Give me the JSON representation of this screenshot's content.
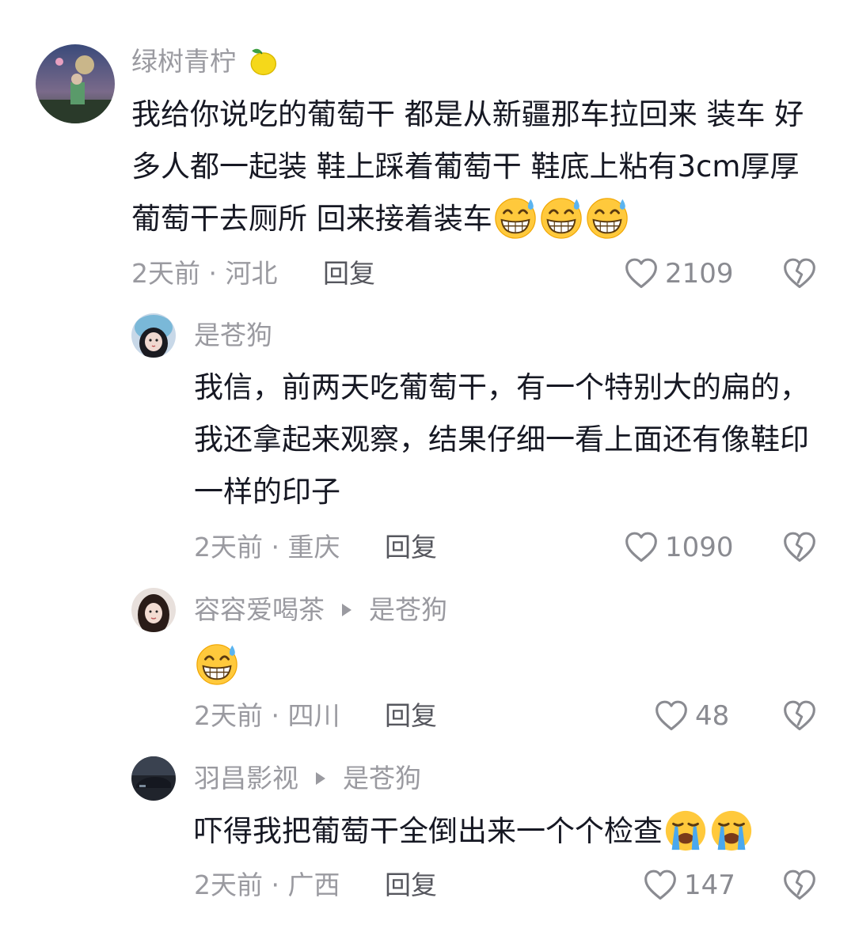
{
  "comments": [
    {
      "username": "绿树青柠",
      "username_icon": "lemon-icon",
      "text": "我给你说吃的葡萄干  都是从新疆那车拉回来  装车 好多人都一起装  鞋上踩着葡萄干  鞋底上粘有3cm厚厚葡萄干去厕所  回来接着装车",
      "emojis": [
        "grin-sweat-emoji",
        "grin-sweat-emoji",
        "grin-sweat-emoji"
      ],
      "meta": "2天前 · 河北",
      "reply_label": "回复",
      "likes": "2109"
    },
    {
      "username": "是苍狗",
      "text": "我信，前两天吃葡萄干，有一个特别大的扁的，我还拿起来观察，结果仔细一看上面还有像鞋印一样的印子",
      "meta": "2天前 · 重庆",
      "reply_label": "回复",
      "likes": "1090"
    },
    {
      "username": "容容爱喝茶",
      "reply_to": "是苍狗",
      "emojis": [
        "grin-sweat-emoji"
      ],
      "meta": "2天前 · 四川",
      "reply_label": "回复",
      "likes": "48"
    },
    {
      "username": "羽昌影视",
      "reply_to": "是苍狗",
      "text": "吓得我把葡萄干全倒出来一个个检查",
      "emojis": [
        "loudly-crying-emoji",
        "loudly-crying-emoji"
      ],
      "meta": "2天前 · 广西",
      "reply_label": "回复",
      "likes": "147"
    }
  ],
  "colors": {
    "text": "#161823",
    "secondary": "#9a9aa0",
    "reply": "#56575e",
    "emoji_yellow": "#ffc93c"
  }
}
